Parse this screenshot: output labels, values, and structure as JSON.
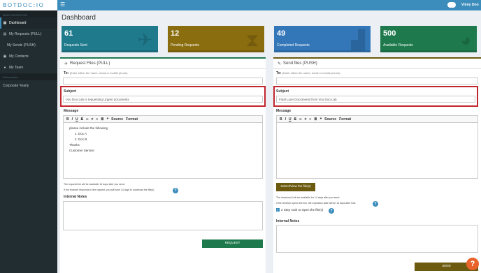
{
  "app": {
    "logo": "BOTDOC:IO",
    "user_name": "Vinny Doo"
  },
  "sidebar": {
    "section_main": "MAIN NAVIGATION",
    "items": [
      {
        "label": "Dashboard",
        "icon": "dashboard-icon"
      },
      {
        "label": "My Requests (PULL)",
        "icon": "inbox-icon"
      },
      {
        "label": "My Sends (PUSH)",
        "icon": "send-icon"
      },
      {
        "label": "My Contacts",
        "icon": "book-icon"
      },
      {
        "label": "My Team",
        "icon": "user-icon"
      }
    ],
    "section_sub": "Subscription",
    "subscription": "Corporate Yearly"
  },
  "page": {
    "title": "Dashboard"
  },
  "stats": [
    {
      "value": "61",
      "label": "Requests Sent",
      "color": "#1f7a8c",
      "icon": "paper-plane-icon"
    },
    {
      "value": "12",
      "label": "Pending Requests",
      "color": "#8a6d0f",
      "icon": "hourglass-icon"
    },
    {
      "value": "49",
      "label": "Completed Requests",
      "color": "#3377b9",
      "icon": "bar-chart-icon"
    },
    {
      "value": "500",
      "label": "Available Requests",
      "color": "#1e7a4d",
      "icon": "pie-chart-icon"
    }
  ],
  "pull": {
    "title": "Request Files (PULL)",
    "to_label": "To:",
    "to_hint": "(Enter either the name, email or mobile phone)",
    "subject_label": "Subject",
    "subject_value": "Voo Doo Lab is requesting Urgent documents",
    "message_label": "Message",
    "body_intro": "please include the following",
    "body_items": [
      "Doc A",
      "Doc B"
    ],
    "body_thanks": "Thanks",
    "body_sign": "Customer Service",
    "note1": "The request link will be available 14 days after you send.",
    "note2": "If the receiver responds to the request, you will have 14 days to download the file(s).",
    "internal_notes_label": "Internal Notes",
    "button": "REQUEST",
    "accent": "#1e7a4d"
  },
  "push": {
    "title": "Send files (PUSH)",
    "to_label": "To:",
    "to_hint": "(Enter either the name, email or mobile phone)",
    "subject_label": "Subject",
    "subject_value": "Final Loan Documents from Voo Doo Lab",
    "message_label": "Message",
    "select_button": "Select/View the file(s)",
    "note1": "The download l,ink be available for 14 days after you send.",
    "note2": "If the receiver opens the link, the expiration date will be 14 days after that.",
    "two_step_label": "2 Step Auth to Open the file(s)",
    "internal_notes_label": "Internal Notes",
    "button": "SEND",
    "accent": "#6b5a10"
  },
  "toolbar": {
    "source": "Source",
    "format": "Format"
  }
}
